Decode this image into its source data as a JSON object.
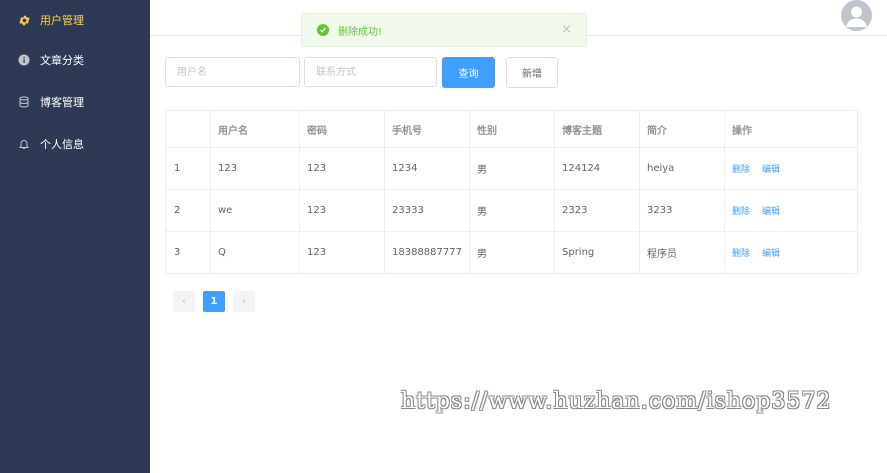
{
  "sidebar": {
    "items": [
      {
        "label": "用户管理",
        "icon": "gear-icon",
        "active": true
      },
      {
        "label": "文章分类",
        "icon": "info-icon",
        "active": false
      },
      {
        "label": "博客管理",
        "icon": "cylinder-icon",
        "active": false
      },
      {
        "label": "个人信息",
        "icon": "bell-icon",
        "active": false
      }
    ],
    "bg_color": "#2e3a55",
    "active_color": "#ffd04b"
  },
  "header": {
    "avatar_icon": "user-avatar-icon"
  },
  "toast": {
    "message": "删除成功!",
    "type": "success",
    "color": "#67c23a"
  },
  "search": {
    "username_placeholder": "用户名",
    "contact_placeholder": "联系方式",
    "query_label": "查询",
    "add_label": "新增"
  },
  "table": {
    "columns": [
      "",
      "用户名",
      "密码",
      "手机号",
      "性别",
      "博客主题",
      "简介",
      "操作"
    ],
    "rows": [
      {
        "id": "1",
        "username": "123",
        "password": "123",
        "phone": "1234",
        "gender": "男",
        "theme": "124124",
        "intro": "heiya"
      },
      {
        "id": "2",
        "username": "we",
        "password": "123",
        "phone": "23333",
        "gender": "男",
        "theme": "2323",
        "intro": "3233"
      },
      {
        "id": "3",
        "username": "Q",
        "password": "123",
        "phone": "18388887777",
        "gender": "男",
        "theme": "Spring",
        "intro": "程序员"
      }
    ],
    "delete_label": "删除",
    "edit_label": "编辑"
  },
  "pagination": {
    "prev": "‹",
    "current": "1",
    "next": "›"
  },
  "watermark": "https://www.huzhan.com/ishop3572",
  "colors": {
    "primary": "#409eff",
    "success": "#67c23a"
  }
}
